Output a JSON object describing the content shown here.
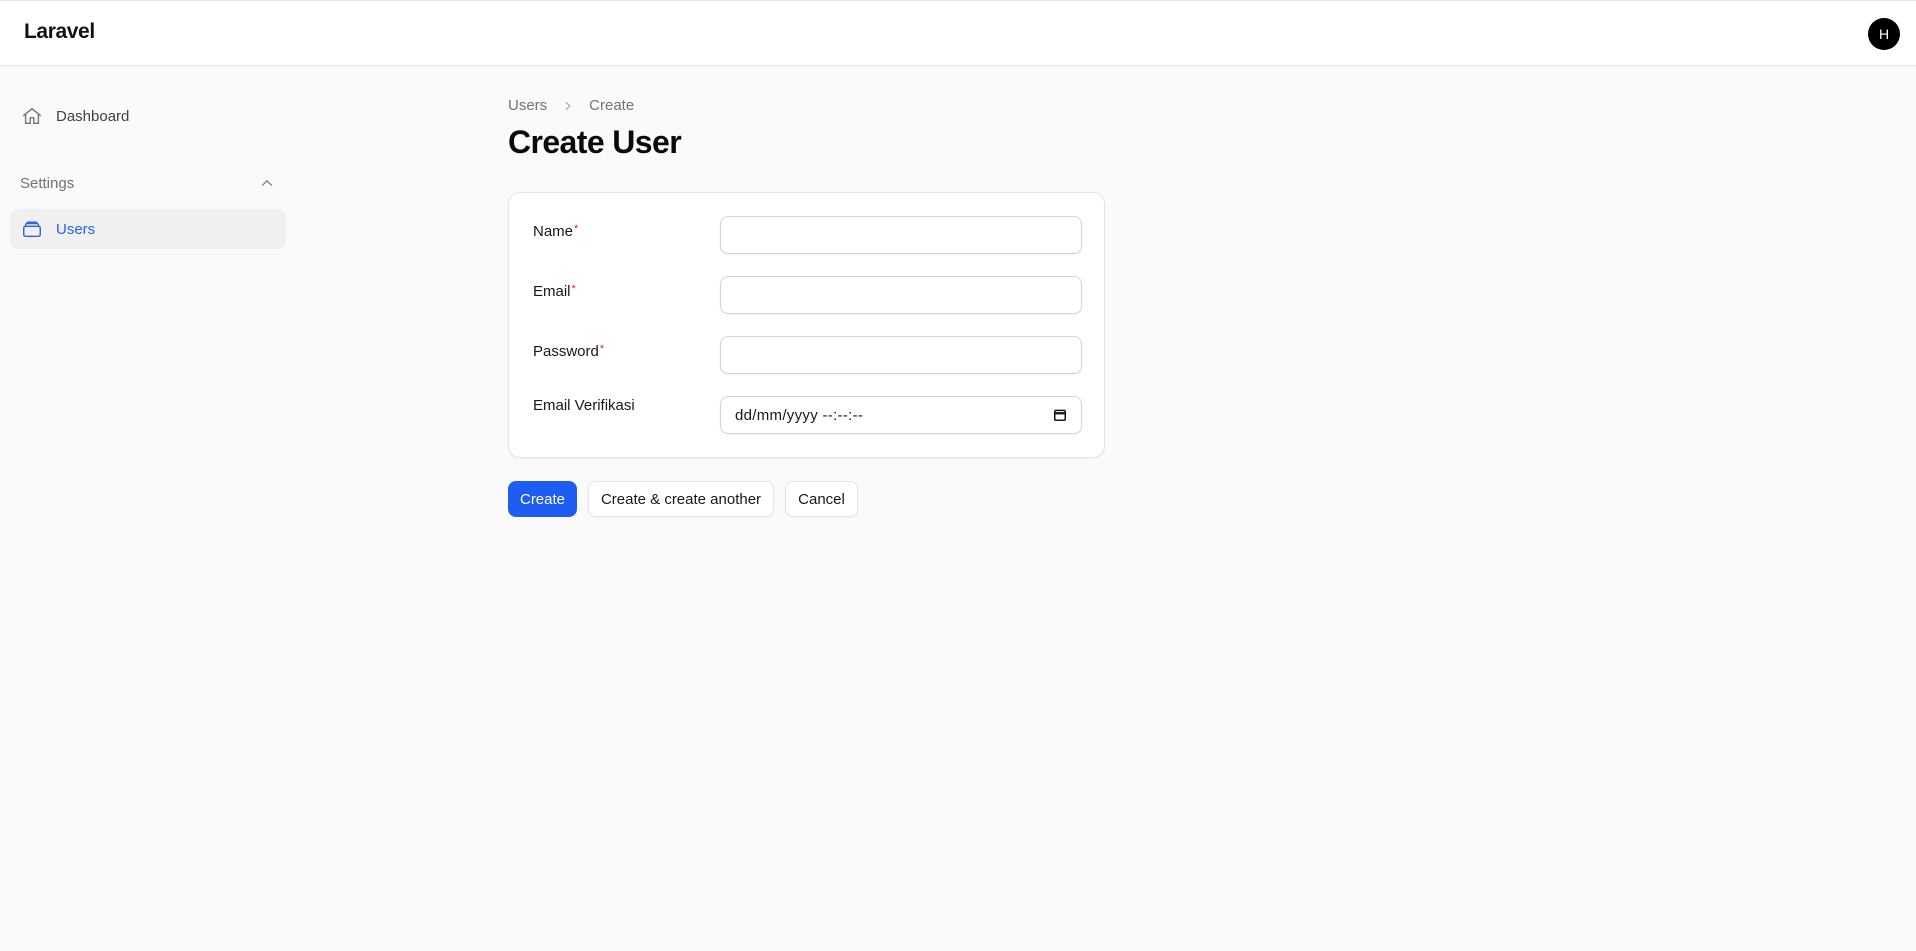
{
  "header": {
    "brand": "Laravel",
    "avatar_initial": "H"
  },
  "sidebar": {
    "items": [
      {
        "label": "Dashboard",
        "icon": "home-icon",
        "active": false
      }
    ],
    "groups": [
      {
        "label": "Settings",
        "collapse_icon": "chevron-up-icon",
        "items": [
          {
            "label": "Users",
            "icon": "users-icon",
            "active": true
          }
        ]
      }
    ]
  },
  "breadcrumb": {
    "items": [
      "Users",
      "Create"
    ]
  },
  "page": {
    "title": "Create User"
  },
  "form": {
    "required_mark": "*",
    "fields": [
      {
        "label": "Name",
        "required": true,
        "type": "text",
        "value": ""
      },
      {
        "label": "Email",
        "required": true,
        "type": "email",
        "value": ""
      },
      {
        "label": "Password",
        "required": true,
        "type": "password",
        "value": ""
      },
      {
        "label": "Email Verifikasi",
        "required": false,
        "type": "datetime-local",
        "placeholder": "dd/mm/yyyy --:--:--"
      }
    ]
  },
  "actions": {
    "create_label": "Create",
    "create_another_label": "Create & create another",
    "cancel_label": "Cancel"
  },
  "colors": {
    "primary": "#1d5df2",
    "active_nav": "#2563eb",
    "required": "#dc2626"
  }
}
